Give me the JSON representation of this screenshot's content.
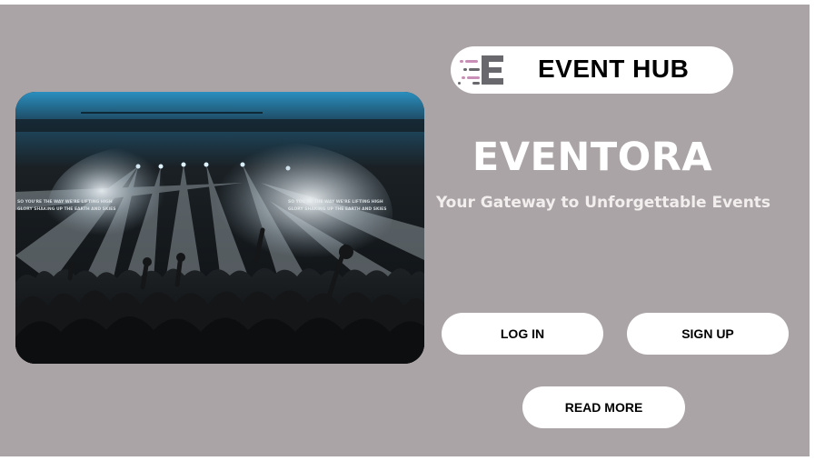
{
  "hero": {
    "image_name": "concert-crowd-photo",
    "stage_text_left": "SO YOU'RE THE WAY WE'RE LIFTING HIGH\nGLORY SHAKING UP THE EARTH AND SKIES",
    "stage_text_right": "SO YOU'RE THE WAY WE'RE LIFTING HIGH\nGLORY SHAKING UP THE EARTH AND SKIES"
  },
  "logo": {
    "icon": "speed-e-icon",
    "text": "EVENT HUB",
    "icon_color": "#6b6b70",
    "accent_color": "#c98fb6"
  },
  "brand": {
    "title": "EVENTORA",
    "tagline": "Your Gateway to Unforgettable Events"
  },
  "actions": {
    "login": "LOG IN",
    "signup": "SIGN UP",
    "read_more": "READ MORE"
  },
  "colors": {
    "background": "#aba4a6",
    "button": "#ffffff",
    "text_dark": "#000000",
    "text_light": "#ffffff"
  }
}
